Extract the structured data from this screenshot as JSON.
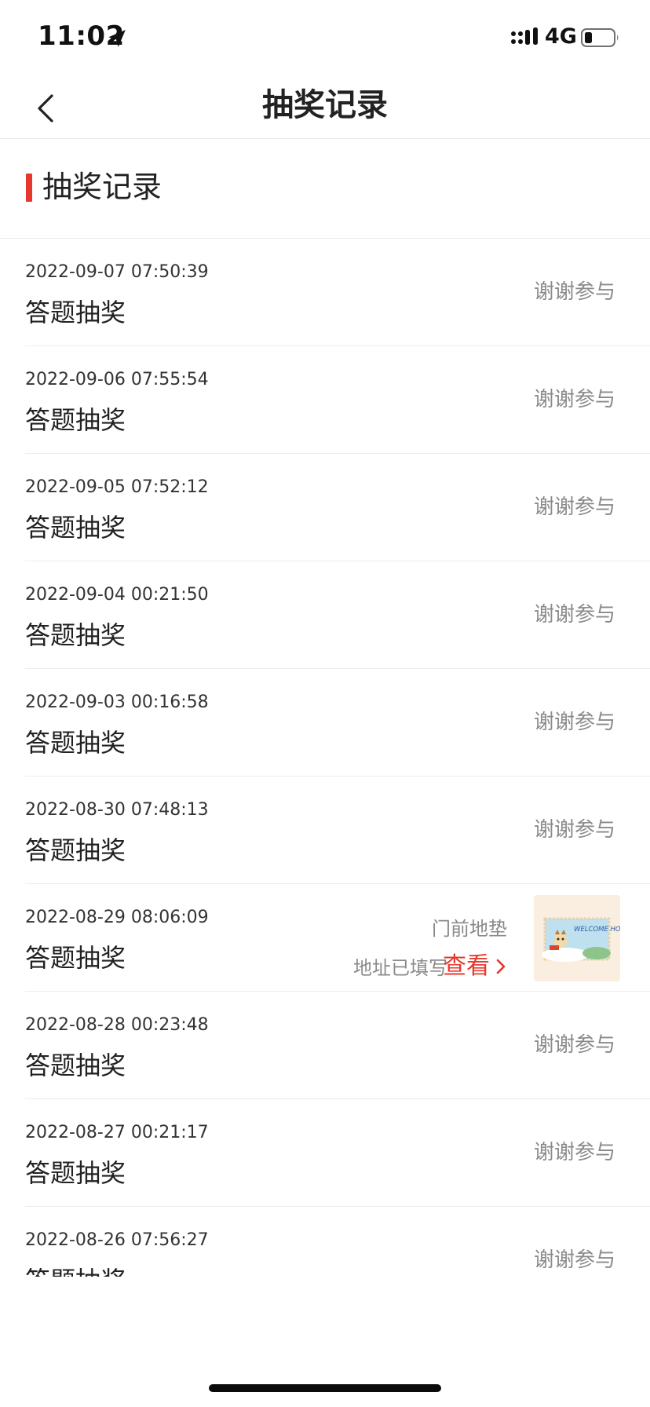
{
  "status_bar": {
    "time": "11:02",
    "network": "4G",
    "icons": [
      "location-arrow-icon",
      "signal-icon",
      "battery-icon"
    ]
  },
  "nav": {
    "title": "抽奖记录",
    "back_icon": "chevron-left-icon"
  },
  "section": {
    "title": "抽奖记录",
    "accent_color": "#e8382d"
  },
  "records": [
    {
      "date": "2022-09-07 07:50:39",
      "title": "答题抽奖",
      "status": "谢谢参与"
    },
    {
      "date": "2022-09-06 07:55:54",
      "title": "答题抽奖",
      "status": "谢谢参与"
    },
    {
      "date": "2022-09-05 07:52:12",
      "title": "答题抽奖",
      "status": "谢谢参与"
    },
    {
      "date": "2022-09-04 00:21:50",
      "title": "答题抽奖",
      "status": "谢谢参与"
    },
    {
      "date": "2022-09-03 00:16:58",
      "title": "答题抽奖",
      "status": "谢谢参与"
    },
    {
      "date": "2022-08-30 07:48:13",
      "title": "答题抽奖",
      "status": "谢谢参与"
    },
    {
      "date": "2022-08-29 08:06:09",
      "title": "答题抽奖",
      "prize_name": "门前地垫",
      "address_status": "地址已填写",
      "view_label": "查看",
      "prize_image": "welcome-home-doormat-image",
      "thumb_text": "WELCOME HOME"
    },
    {
      "date": "2022-08-28 00:23:48",
      "title": "答题抽奖",
      "status": "谢谢参与"
    },
    {
      "date": "2022-08-27 00:21:17",
      "title": "答题抽奖",
      "status": "谢谢参与"
    },
    {
      "date": "2022-08-26 07:56:27",
      "title": "答题抽奖",
      "status": "谢谢参与"
    }
  ],
  "colors": {
    "accent": "#e8382d",
    "muted_text": "#8a8a8a",
    "divider": "#ededed"
  }
}
